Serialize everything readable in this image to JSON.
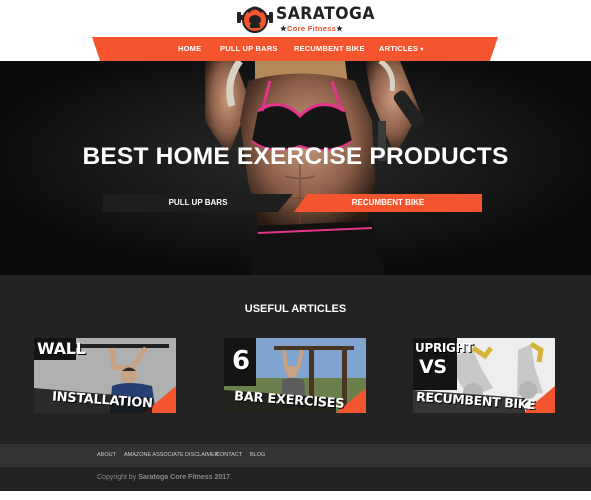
{
  "brand": {
    "title": "SARATOGA",
    "subtitle": "Core Fitness",
    "accent": "#f4552e",
    "dark": "#232323"
  },
  "nav": {
    "home": "HOME",
    "pull_up_bars": "PULL UP BARS",
    "recumbent_bike": "RECUMBENT BIKE",
    "articles": "ARTICLES"
  },
  "hero": {
    "title": "BEST HOME EXERCISE PRODUCTS",
    "btn_pull": "PULL UP BARS",
    "btn_recumbent": "RECUMBENT BIKE"
  },
  "articles": {
    "heading": "USEFUL ARTICLES",
    "cards": [
      {
        "top": "WALL",
        "bottom": "INSTALLATION"
      },
      {
        "top": "6",
        "bottom": "BAR EXERCISES"
      },
      {
        "top": "UPRIGHT",
        "middle": "VS",
        "bottom": "RECUMBENT BIKE"
      }
    ]
  },
  "footer": {
    "links": [
      "ABOUT",
      "AMAZONE ASSOCIATE DISCLAIMER",
      "CONTACT",
      "BLOG"
    ],
    "copyright_prefix": "Copyright by ",
    "copyright_name": "Saratoga Core Fitness 2017",
    "copyright_suffix": "."
  }
}
